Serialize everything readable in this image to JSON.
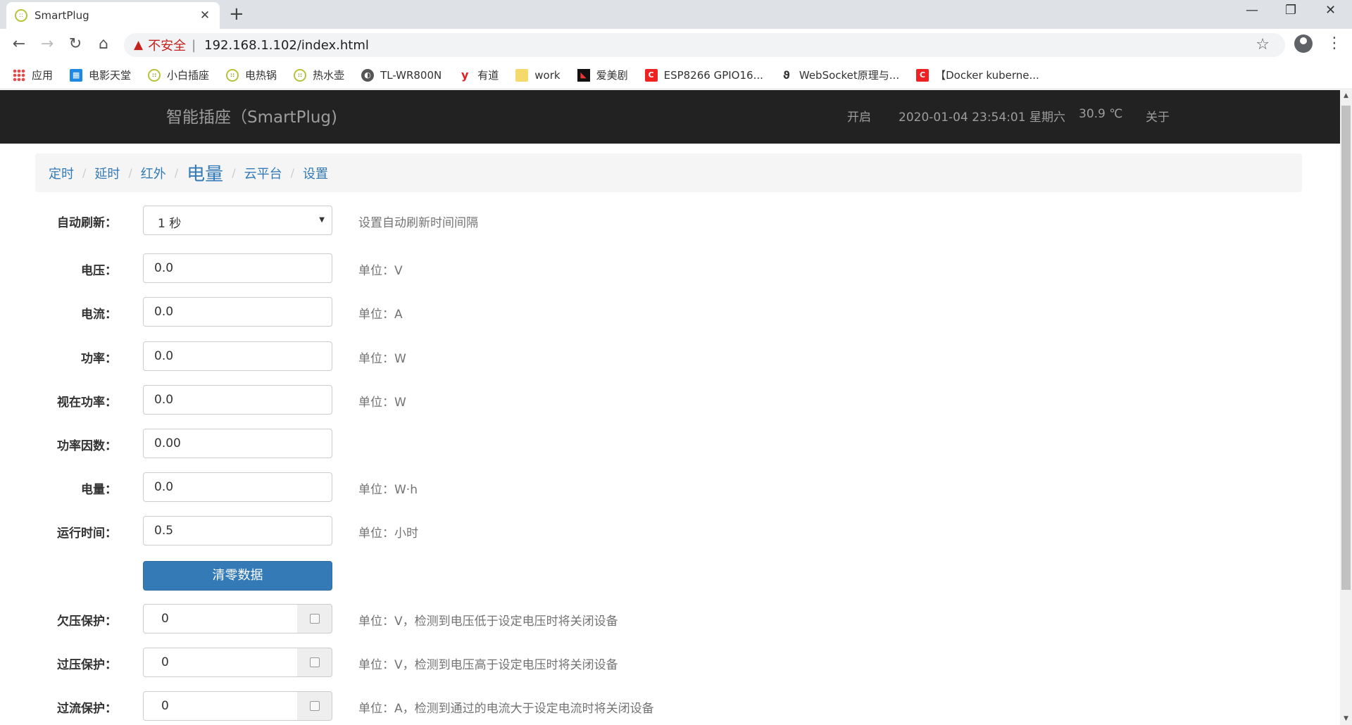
{
  "browser": {
    "tab_title": "SmartPlug",
    "tab_favicon_glyph": "::",
    "new_tab": "+",
    "security_label": "不安全",
    "url": "192.168.1.102/index.html",
    "bookmarks": [
      {
        "icon": "apps-icon",
        "label": "应用"
      },
      {
        "icon": "movie-icon",
        "label": "电影天堂"
      },
      {
        "icon": "plug-icon",
        "label": "小白插座"
      },
      {
        "icon": "plug-icon",
        "label": "电热锅"
      },
      {
        "icon": "plug-icon",
        "label": "热水壶"
      },
      {
        "icon": "globe-icon",
        "label": "TL-WR800N"
      },
      {
        "icon": "youdao-icon",
        "label": "有道"
      },
      {
        "icon": "folder-icon",
        "label": "work"
      },
      {
        "icon": "aimeiju-icon",
        "label": "爱美剧"
      },
      {
        "icon": "csdn-icon",
        "label": "ESP8266 GPIO16..."
      },
      {
        "icon": "websocket-icon",
        "label": "WebSocket原理与..."
      },
      {
        "icon": "csdn-icon",
        "label": "【Docker kuberne..."
      }
    ]
  },
  "navbar": {
    "brand": "智能插座（SmartPlug)",
    "status": "开启",
    "datetime": "2020-01-04 23:54:01 星期六",
    "temperature": "30.9 ℃",
    "about": "关于"
  },
  "breadcrumb": {
    "items": [
      "定时",
      "延时",
      "红外",
      "电量",
      "云平台",
      "设置"
    ],
    "active": "电量",
    "separator": "/"
  },
  "form": {
    "auto_refresh": {
      "label": "自动刷新：",
      "value": "1 秒",
      "help": "设置自动刷新时间间隔"
    },
    "voltage": {
      "label": "电压：",
      "value": "0.0",
      "help": "单位：V"
    },
    "current": {
      "label": "电流：",
      "value": "0.0",
      "help": "单位：A"
    },
    "power": {
      "label": "功率：",
      "value": "0.0",
      "help": "单位：W"
    },
    "apparent_power": {
      "label": "视在功率：",
      "value": "0.0",
      "help": "单位：W"
    },
    "power_factor": {
      "label": "功率因数：",
      "value": "0.00",
      "help": ""
    },
    "energy": {
      "label": "电量：",
      "value": "0.0",
      "help": "单位：W·h"
    },
    "runtime": {
      "label": "运行时间：",
      "value": "0.5",
      "help": "单位：小时"
    },
    "clear_button": "清零数据",
    "undervoltage": {
      "label": "欠压保护：",
      "value": "0",
      "help": "单位：V，检测到电压低于设定电压时将关闭设备",
      "checked": false
    },
    "overvoltage": {
      "label": "过压保护：",
      "value": "0",
      "help": "单位：V，检测到电压高于设定电压时将关闭设备",
      "checked": false
    },
    "overcurrent": {
      "label": "过流保护：",
      "value": "0",
      "help": "单位：A，检测到通过的电流大于设定电流时将关闭设备",
      "checked": false
    }
  }
}
